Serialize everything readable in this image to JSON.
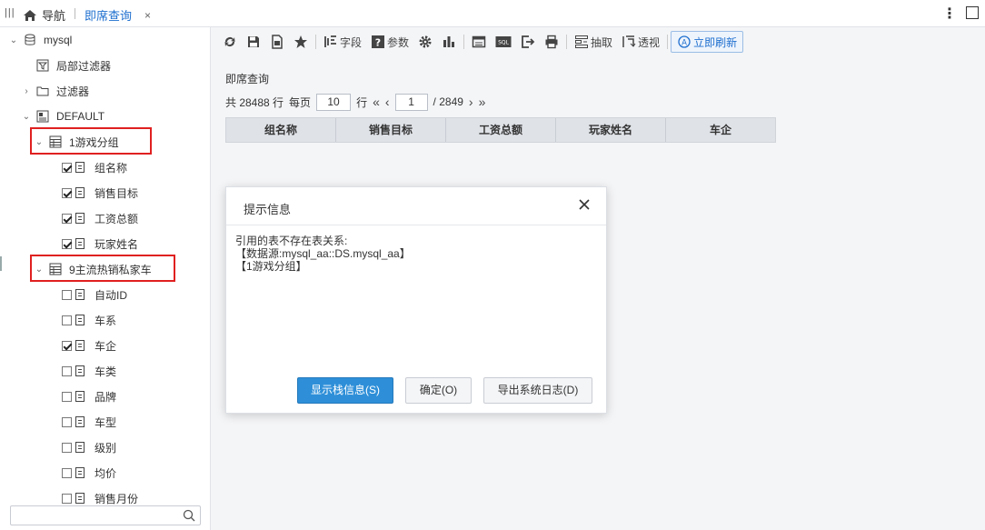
{
  "topbar": {
    "menu_icon": "|||",
    "home_label": "导航",
    "tab_label": "即席查询",
    "tab_close": "×",
    "more_icon": "⋮"
  },
  "sidebar": {
    "root": "mysql",
    "local_filter": "局部过滤器",
    "filter": "过滤器",
    "default": "DEFAULT",
    "group1": {
      "label": "1游戏分组",
      "fields": [
        {
          "label": "组名称",
          "checked": true
        },
        {
          "label": "销售目标",
          "checked": true
        },
        {
          "label": "工资总额",
          "checked": true
        },
        {
          "label": "玩家姓名",
          "checked": true
        }
      ]
    },
    "group2": {
      "label": "9主流热销私家车",
      "fields": [
        {
          "label": "自动ID",
          "checked": false
        },
        {
          "label": "车系",
          "checked": false
        },
        {
          "label": "车企",
          "checked": true
        },
        {
          "label": "车类",
          "checked": false
        },
        {
          "label": "品牌",
          "checked": false
        },
        {
          "label": "车型",
          "checked": false
        },
        {
          "label": "级别",
          "checked": false
        },
        {
          "label": "均价",
          "checked": false
        },
        {
          "label": "销售月份",
          "checked": false
        }
      ]
    },
    "search_placeholder": ""
  },
  "toolbar": {
    "field_label": "字段",
    "param_label": "参数",
    "extract_label": "抽取",
    "pivot_label": "透视",
    "refresh_label": "立即刷新"
  },
  "main": {
    "title": "即席查询",
    "pager": {
      "total_prefix": "共 28488 行",
      "per_page_label": "每页",
      "per_page_value": "10",
      "rows_label": "行",
      "current_page": "1",
      "total_pages": "/ 2849"
    },
    "columns": [
      "组名称",
      "销售目标",
      "工资总额",
      "玩家姓名",
      "车企"
    ]
  },
  "dialog": {
    "title": "提示信息",
    "line1": "引用的表不存在表关系:",
    "line2": "【数据源:mysql_aa::DS.mysql_aa】",
    "line3": "【1游戏分组】",
    "btn_stack": "显示栈信息(S)",
    "btn_ok": "确定(O)",
    "btn_export": "导出系统日志(D)"
  },
  "colors": {
    "accent": "#1e6fcf",
    "primary_button": "#2e8fd8",
    "highlight_box": "#e02020"
  }
}
